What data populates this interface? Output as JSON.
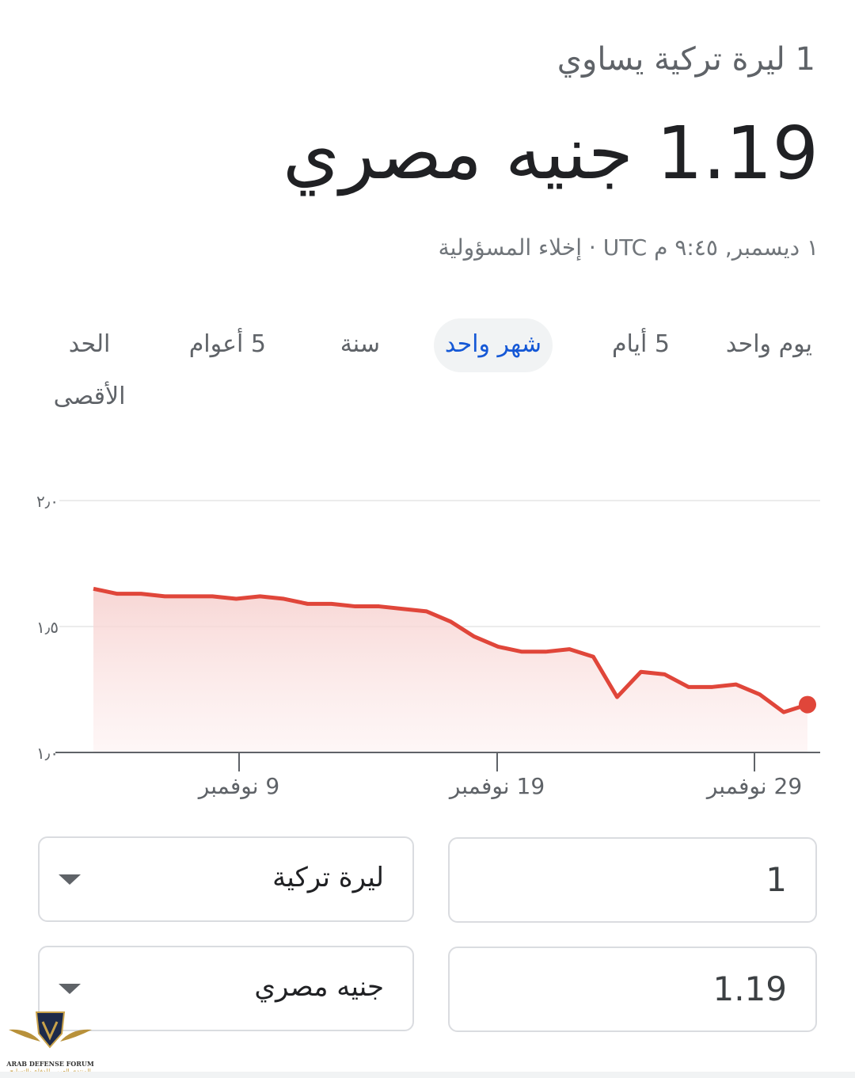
{
  "header": {
    "subtitle": "1 ليرة تركية يساوي",
    "amount": "1.19 جنيه مصري",
    "meta": "١ ديسمبر, ٩:٤٥ م UTC · إخلاء المسؤولية"
  },
  "tabs": [
    {
      "label": "يوم واحد",
      "active": false
    },
    {
      "label": "5 أيام",
      "active": false
    },
    {
      "label": "شهر واحد",
      "active": true
    },
    {
      "label": "سنة",
      "active": false
    },
    {
      "label": "5 أعوام",
      "active": false
    },
    {
      "label": "الحد الأقصى",
      "active": false
    }
  ],
  "chart_data": {
    "type": "area",
    "ylim": [
      1.0,
      2.0
    ],
    "yticks": [
      "١٫٠",
      "١٫٥",
      "٢٫٠"
    ],
    "ytick_values": [
      1.0,
      1.5,
      2.0
    ],
    "xticks": [
      "9 نوفمبر",
      "19 نوفمبر",
      "29 نوفمبر"
    ],
    "grid": true,
    "color": "#e0463a",
    "values": [
      1.65,
      1.63,
      1.63,
      1.62,
      1.62,
      1.62,
      1.61,
      1.62,
      1.61,
      1.59,
      1.59,
      1.58,
      1.58,
      1.57,
      1.56,
      1.52,
      1.46,
      1.42,
      1.4,
      1.4,
      1.41,
      1.38,
      1.22,
      1.32,
      1.31,
      1.26,
      1.26,
      1.27,
      1.23,
      1.16,
      1.19
    ]
  },
  "converter": {
    "from_value": "1",
    "from_currency": "ليرة تركية",
    "to_value": "1.19",
    "to_currency": "جنيه مصري"
  },
  "watermark": {
    "text": "ARAB DEFENSE FORUM",
    "arabic": "المنتدى العربي للدفاع والتسليح",
    "mark": "DA"
  }
}
